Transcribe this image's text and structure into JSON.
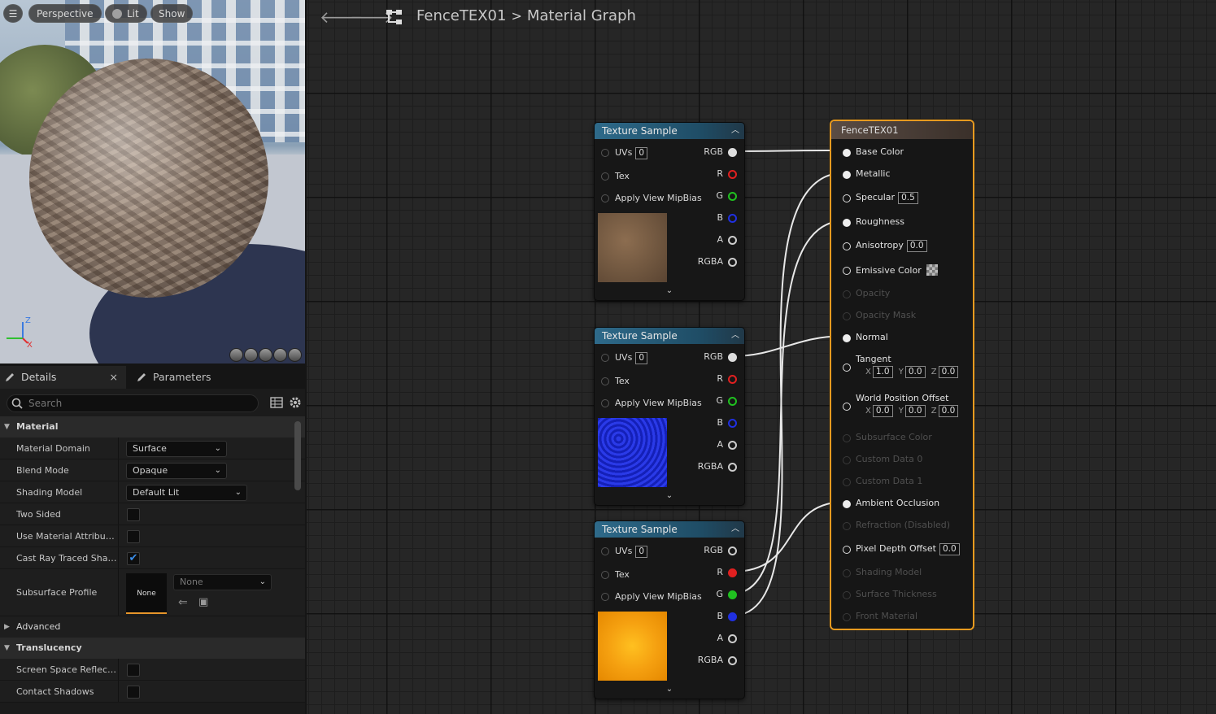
{
  "viewport": {
    "menu_icon": "hamburger-icon",
    "perspective_label": "Perspective",
    "lit_label": "Lit",
    "show_label": "Show",
    "axis_z": "Z",
    "axis_x": "X"
  },
  "details": {
    "tab_details": "Details",
    "tab_close": "×",
    "tab_parameters": "Parameters",
    "search_placeholder": "Search",
    "section_material": "Material",
    "section_advanced": "Advanced",
    "section_translucency": "Translucency",
    "rows": {
      "material_domain": {
        "label": "Material Domain",
        "value": "Surface"
      },
      "blend_mode": {
        "label": "Blend Mode",
        "value": "Opaque"
      },
      "shading_model": {
        "label": "Shading Model",
        "value": "Default Lit"
      },
      "two_sided": {
        "label": "Two Sided",
        "checked": false
      },
      "use_material_attributes": {
        "label": "Use Material Attributes",
        "checked": false
      },
      "cast_ray_traced": {
        "label": "Cast Ray Traced Shad...",
        "checked": true
      },
      "subsurface_profile": {
        "label": "Subsurface Profile",
        "thumb_text": "None",
        "value": "None"
      },
      "screen_space_reflections": {
        "label": "Screen Space Reflecti...",
        "checked": false
      },
      "contact_shadows": {
        "label": "Contact Shadows",
        "checked": false
      }
    }
  },
  "graph": {
    "asset_name": "FenceTEX01",
    "separator": ">",
    "graph_title": "Material Graph",
    "texture_nodes": [
      {
        "title": "Texture Sample",
        "uvs_label": "UVs",
        "uvs_value": "0",
        "tex_label": "Tex",
        "mip_label": "Apply View MipBias",
        "outputs": [
          "RGB",
          "R",
          "G",
          "B",
          "A",
          "RGBA"
        ],
        "thumb": "brown"
      },
      {
        "title": "Texture Sample",
        "uvs_label": "UVs",
        "uvs_value": "0",
        "tex_label": "Tex",
        "mip_label": "Apply View MipBias",
        "outputs": [
          "RGB",
          "R",
          "G",
          "B",
          "A",
          "RGBA"
        ],
        "thumb": "blue"
      },
      {
        "title": "Texture Sample",
        "uvs_label": "UVs",
        "uvs_value": "0",
        "tex_label": "Tex",
        "mip_label": "Apply View MipBias",
        "outputs": [
          "RGB",
          "R",
          "G",
          "B",
          "A",
          "RGBA"
        ],
        "thumb": "orange"
      }
    ],
    "material_node": {
      "title": "FenceTEX01",
      "inputs": {
        "base_color": "Base Color",
        "metallic": "Metallic",
        "specular": "Specular",
        "specular_value": "0.5",
        "roughness": "Roughness",
        "anisotropy": "Anisotropy",
        "anisotropy_value": "0.0",
        "emissive_color": "Emissive Color",
        "opacity": "Opacity",
        "opacity_mask": "Opacity Mask",
        "normal": "Normal",
        "tangent": "Tangent",
        "tangent_x": "1.0",
        "tangent_y": "0.0",
        "tangent_z": "0.0",
        "world_position_offset": "World Position Offset",
        "wpo_x": "0.0",
        "wpo_y": "0.0",
        "wpo_z": "0.0",
        "subsurface_color": "Subsurface Color",
        "custom_data_0": "Custom Data 0",
        "custom_data_1": "Custom Data 1",
        "ambient_occlusion": "Ambient Occlusion",
        "refraction": "Refraction (Disabled)",
        "pixel_depth_offset": "Pixel Depth Offset",
        "pixel_depth_offset_value": "0.0",
        "shading_model": "Shading Model",
        "surface_thickness": "Surface Thickness",
        "front_material": "Front Material",
        "axis_x": "X",
        "axis_y": "Y",
        "axis_z": "Z"
      }
    }
  },
  "colors": {
    "node_header": "#2e6a8a",
    "material_node_border": "#e79a1f",
    "pin_r": "#e02020",
    "pin_g": "#20c020",
    "pin_b": "#2030e0",
    "checkbox_check": "#3b8eea"
  }
}
